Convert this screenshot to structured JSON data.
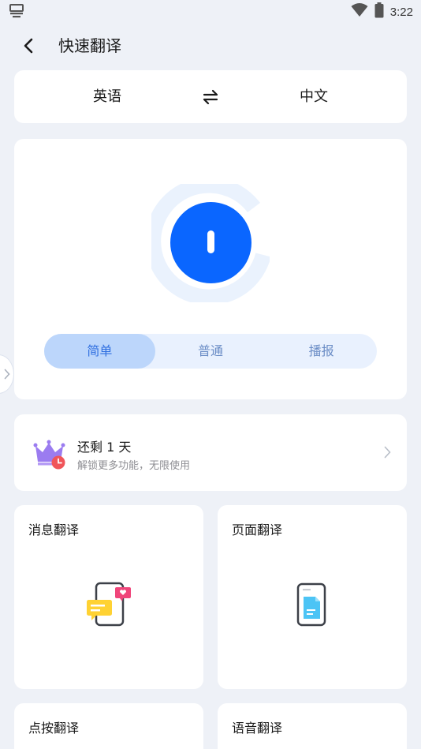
{
  "status_bar": {
    "time": "3:22",
    "icons": [
      "notification-icon",
      "wifi-icon",
      "battery-icon"
    ]
  },
  "header": {
    "title": "快速翻译",
    "back_icon": "back-arrow-icon"
  },
  "languages": {
    "source": "英语",
    "target": "中文",
    "swap_icon": "swap-icon"
  },
  "modes": {
    "items": [
      "简单",
      "普通",
      "播报"
    ],
    "selected": "简单"
  },
  "promo": {
    "title": "还剩 1 天",
    "subtitle": "解锁更多功能，无限使用",
    "icon": "crown-icon"
  },
  "features": [
    {
      "label": "消息翻译",
      "icon": "message-phone-icon"
    },
    {
      "label": "页面翻译",
      "icon": "page-phone-icon"
    },
    {
      "label": "点按翻译"
    },
    {
      "label": "语音翻译"
    }
  ],
  "colors": {
    "accent": "#0a66ff",
    "background": "#eef1f7",
    "segment_active": "#bcd6fb",
    "segment_bg": "#e9f1fe",
    "crown": "#9b7cf0",
    "badge": "#f0555a"
  }
}
